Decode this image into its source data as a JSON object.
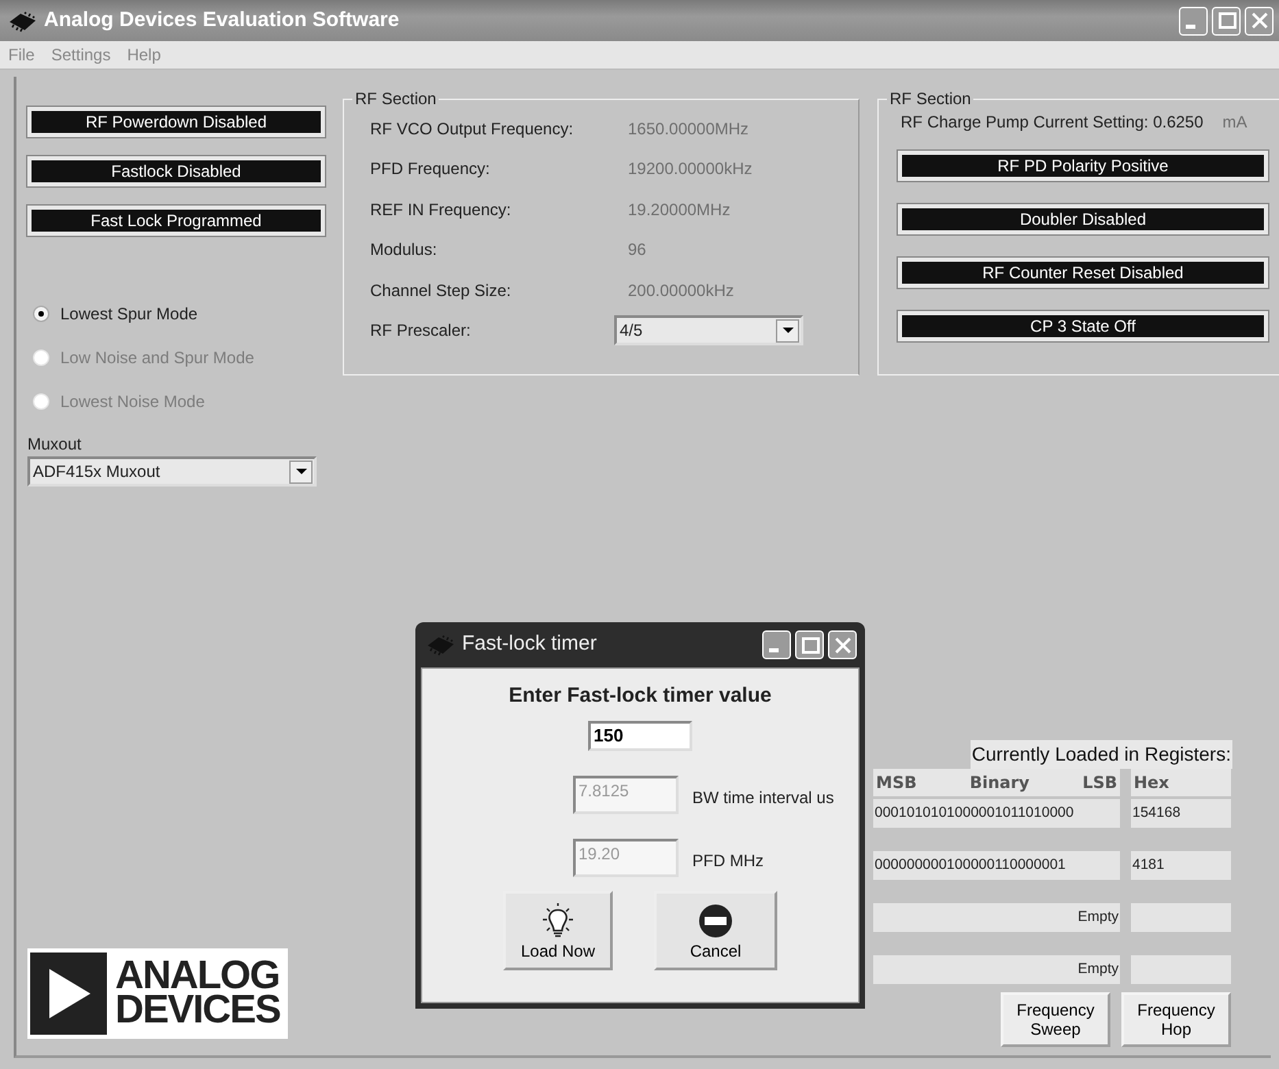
{
  "window": {
    "title": "Analog Devices Evaluation Software"
  },
  "menu": [
    {
      "label": "File"
    },
    {
      "label": "Settings"
    },
    {
      "label": "Help"
    }
  ],
  "left_buttons": [
    {
      "label": "RF Powerdown Disabled"
    },
    {
      "label": "Fastlock Disabled"
    },
    {
      "label": "Fast Lock Programmed"
    }
  ],
  "modes": [
    {
      "label": "Lowest Spur Mode",
      "selected": true,
      "disabled": false
    },
    {
      "label": "Low Noise and Spur Mode",
      "selected": false,
      "disabled": true
    },
    {
      "label": "Lowest Noise Mode",
      "selected": false,
      "disabled": true
    }
  ],
  "muxout": {
    "label": "Muxout",
    "value": "ADF415x Muxout"
  },
  "rf_section_1": {
    "title": "RF Section",
    "rows": [
      {
        "kind": "text",
        "label": "RF VCO Output Frequency:",
        "value": "1650.00000MHz"
      },
      {
        "kind": "text",
        "label": "PFD Frequency:",
        "value": "19200.00000kHz"
      },
      {
        "kind": "text",
        "label": "REF IN Frequency:",
        "value": "19.20000MHz"
      },
      {
        "kind": "text",
        "label": "Modulus:",
        "value": "96"
      },
      {
        "kind": "text",
        "label": "Channel Step Size:",
        "value": "200.00000kHz"
      },
      {
        "kind": "select",
        "label": "RF Prescaler:",
        "value": "4/5"
      }
    ]
  },
  "rf_section_2": {
    "title": "RF Section",
    "charge_pump": {
      "label": "RF Charge Pump Current Setting: 0.6250",
      "unit": "mA"
    },
    "buttons": [
      {
        "label": "RF PD Polarity Positive"
      },
      {
        "label": "Doubler Disabled"
      },
      {
        "label": "RF Counter Reset Disabled"
      },
      {
        "label": "CP 3 State Off"
      }
    ]
  },
  "registers": {
    "title": "Currently Loaded in Registers:",
    "columns": [
      "MSB",
      "Binary",
      "LSB",
      "Hex"
    ],
    "rows": [
      {
        "binary": "0001010101000001011010000",
        "hex": "154168"
      },
      {
        "binary": "000000000100000110000001",
        "hex": "4181"
      },
      {
        "binary": "Empty",
        "hex": ""
      },
      {
        "binary": "Empty",
        "hex": ""
      }
    ],
    "buttons": [
      {
        "label": "Frequency Sweep"
      },
      {
        "label": "Frequency Hop"
      }
    ]
  },
  "logo": {
    "lines": [
      "ANALOG",
      "DEVICES"
    ]
  },
  "dialog": {
    "title": "Fast-lock timer",
    "heading": "Enter Fast-lock timer value",
    "timer_value": "150",
    "fields": [
      {
        "value": "7.8125",
        "label": "BW time interval us"
      },
      {
        "value": "19.20",
        "label": "PFD MHz"
      }
    ],
    "buttons": [
      {
        "kind": "bulb",
        "label": "Load Now"
      },
      {
        "kind": "stop",
        "label": "Cancel"
      }
    ]
  }
}
